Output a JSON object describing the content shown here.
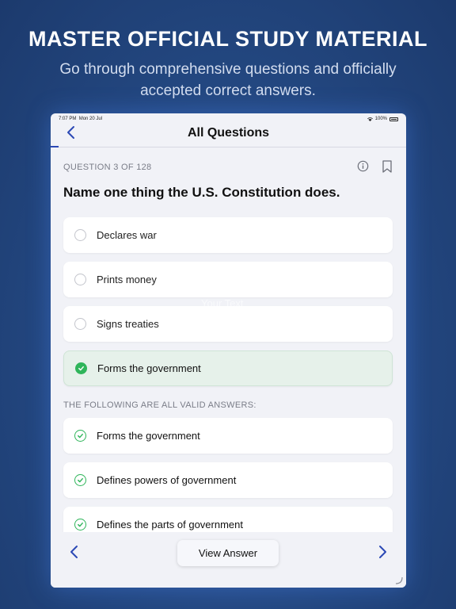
{
  "promo": {
    "headline": "MASTER OFFICIAL STUDY MATERIAL",
    "subhead": "Go through comprehensive questions and officially accepted correct answers."
  },
  "status_bar": {
    "time": "7:07 PM",
    "date": "Mon 20 Jul",
    "battery": "100%"
  },
  "nav": {
    "title": "All Questions",
    "back_icon": "chevron-left-icon"
  },
  "question": {
    "counter": "QUESTION 3 OF 128",
    "text": "Name one thing the U.S. Constitution does."
  },
  "options": [
    {
      "label": "Declares war",
      "state": "unselected"
    },
    {
      "label": "Prints money",
      "state": "unselected"
    },
    {
      "label": "Signs treaties",
      "state": "unselected"
    },
    {
      "label": "Forms the government",
      "state": "correct"
    }
  ],
  "valid_answers": {
    "heading": "THE FOLLOWING ARE ALL VALID ANSWERS:",
    "items": [
      {
        "label": "Forms the government"
      },
      {
        "label": "Defines powers of government"
      },
      {
        "label": "Defines the parts of government"
      }
    ]
  },
  "watermark": "Your Text",
  "footer": {
    "view_answer_label": "View Answer"
  },
  "colors": {
    "accent": "#2b49b5",
    "correct": "#2fb55a",
    "correct_bg": "#e6f1ea"
  }
}
